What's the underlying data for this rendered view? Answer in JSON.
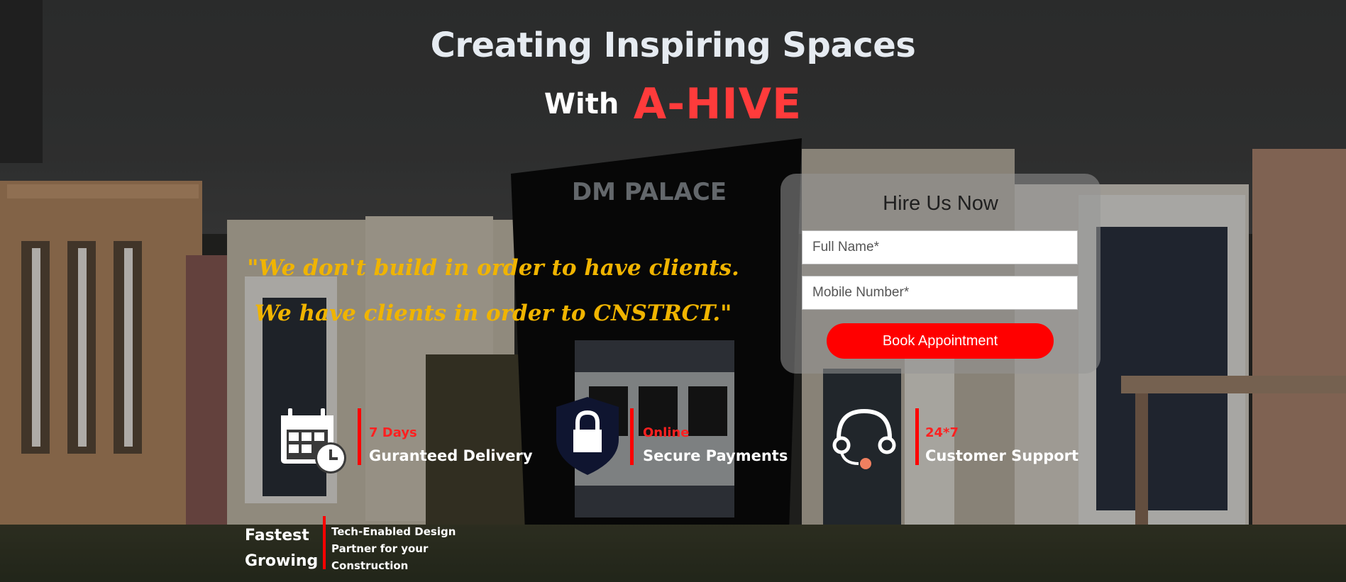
{
  "hero": {
    "title": "Creating Inspiring Spaces",
    "with_text": "With",
    "brand": "A-HIVE"
  },
  "background": {
    "sign_text": "DM PALACE"
  },
  "quote": {
    "line1": "\"We don't build in order to have clients.",
    "line2": "We have clients in order to CNSTRCT.\""
  },
  "form": {
    "title": "Hire Us Now",
    "full_name_placeholder": "Full Name*",
    "mobile_placeholder": "Mobile Number*",
    "submit_label": "Book Appointment"
  },
  "features": [
    {
      "icon": "calendar-clock-icon",
      "top": "7 Days",
      "bottom": "Guranteed Delivery"
    },
    {
      "icon": "shield-lock-icon",
      "top": "Online",
      "bottom": "Secure Payments"
    },
    {
      "icon": "headset-icon",
      "top": "24*7",
      "bottom": "Customer Support"
    }
  ],
  "tagline": {
    "heading_line1": "Fastest",
    "heading_line2": "Growing",
    "desc_line1": "Tech-Enabled Design",
    "desc_line2": "Partner for your",
    "desc_line3": "Construction"
  },
  "colors": {
    "accent_red": "#ff0000",
    "brand_red": "#ff3b3b",
    "quote_gold": "#f0b400",
    "title_white": "#e6ebf1"
  }
}
